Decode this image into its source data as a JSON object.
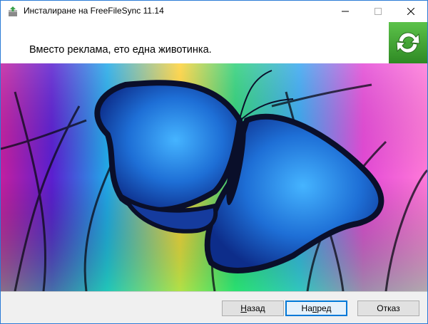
{
  "window": {
    "title": "Инсталиране на FreeFileSync 11.14",
    "app_icon": "installer-box-icon",
    "controls": [
      "minimize-icon",
      "maximize-icon",
      "close-icon"
    ]
  },
  "header": {
    "text": "Вместо реклама, ето една животинка.",
    "logo": "freefilesync-sync-arrows-icon"
  },
  "image": {
    "subject": "blue morpho butterfly on colorful grass",
    "colors": {
      "wing_blue": "#1e6fd6",
      "wing_dark": "#0a0f2a"
    }
  },
  "buttons": {
    "back": {
      "pre": "",
      "accel": "Н",
      "post": "азад"
    },
    "next": {
      "pre": "На",
      "accel": "п",
      "post": "ред"
    },
    "cancel": {
      "label": "Отказ"
    }
  },
  "theme": {
    "accent": "#0078d7",
    "logo_green": "#3a9c2e"
  }
}
